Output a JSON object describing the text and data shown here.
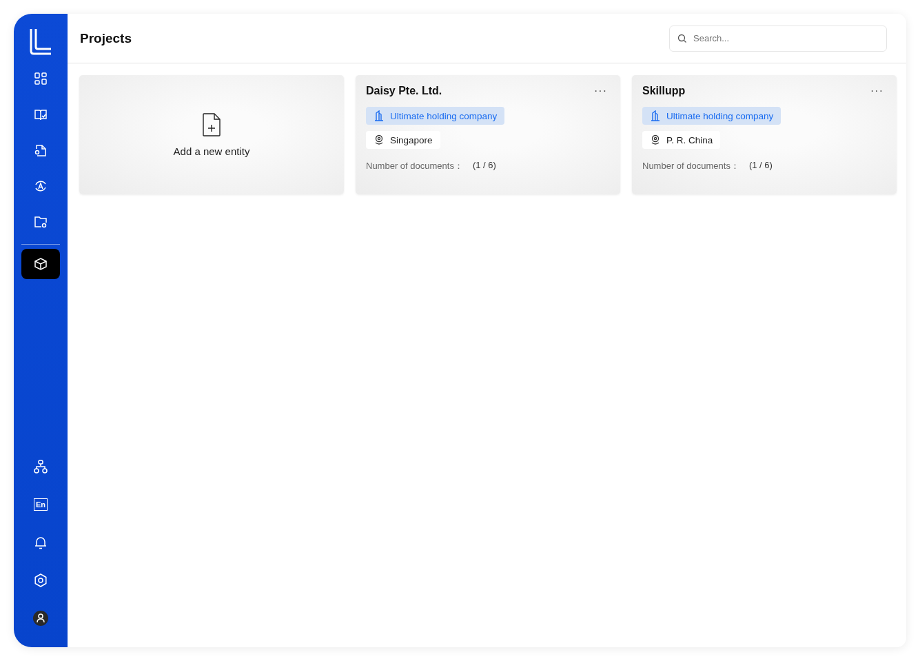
{
  "sidebar": {
    "top_items": [
      {
        "kind": "grid",
        "selected": false
      },
      {
        "kind": "book",
        "selected": false
      },
      {
        "kind": "doc",
        "selected": false
      },
      {
        "kind": "cycle",
        "selected": false
      },
      {
        "kind": "folder",
        "selected": false
      },
      {
        "kind": "cube",
        "selected": true
      }
    ],
    "bottom_items": [
      {
        "kind": "org"
      },
      {
        "kind": "lang",
        "label": "En"
      },
      {
        "kind": "bell"
      },
      {
        "kind": "gear"
      },
      {
        "kind": "avatar"
      }
    ]
  },
  "header": {
    "title": "Projects",
    "search": {
      "placeholder": "Search..."
    }
  },
  "add_card": {
    "label": "Add a new entity"
  },
  "entities": [
    {
      "name": "Daisy Pte. Ltd.",
      "menu": "···",
      "role": "Ultimate holding company",
      "location": "Singapore",
      "documents_label": "Number of documents：",
      "documents_count": "(1 / 6)"
    },
    {
      "name": "Skillupp",
      "menu": "···",
      "role": "Ultimate holding company",
      "location": "P. R. China",
      "documents_label": "Number of documents：",
      "documents_count": "(1 / 6)"
    }
  ]
}
